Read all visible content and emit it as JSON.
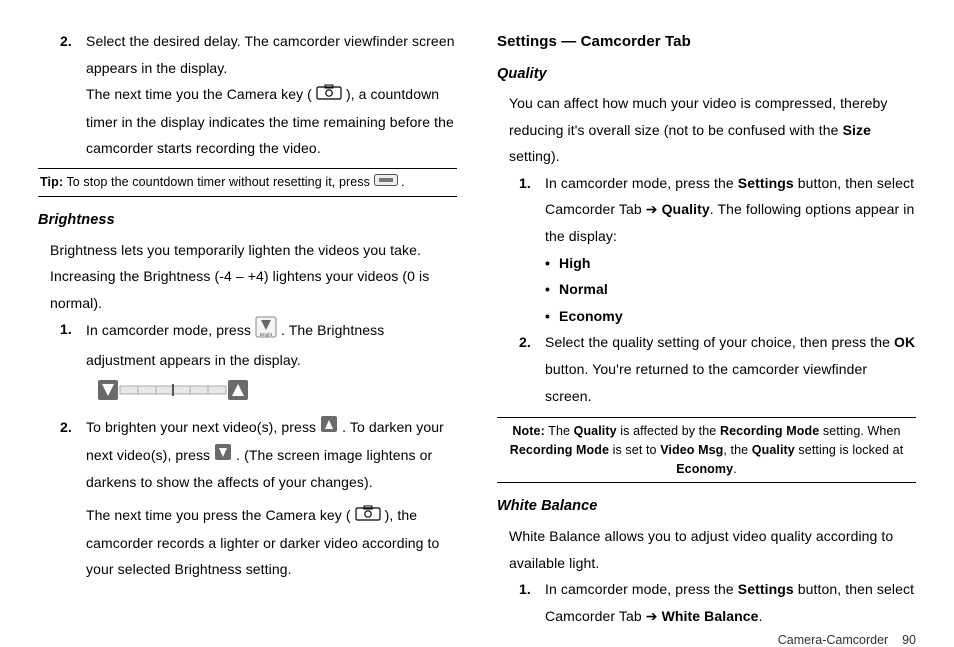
{
  "left": {
    "step2a": "Select the desired delay. The camcorder viewfinder screen appears in the display.",
    "step2b_pre": "The next time you the Camera key (",
    "step2b_post": "), a countdown timer in the display indicates the time remaining before the camcorder starts recording the video.",
    "tip_label": "Tip:",
    "tip_text_pre": " To stop the countdown timer without resetting it, press ",
    "tip_text_post": " .",
    "brightness_heading": "Brightness",
    "brightness_intro": "Brightness lets you temporarily lighten the videos you take. Increasing the Brightness (-4 – +4) lightens your videos (0 is normal).",
    "b_step1_pre": "In camcorder mode, press ",
    "b_step1_post": ". The Brightness adjustment appears in the display.",
    "b_step2_pre": "To brighten your next video(s), press ",
    "b_step2_mid": ". To darken your next video(s), press ",
    "b_step2_post": ". (The screen image lightens or darkens to show the affects of your changes).",
    "b_step2_para2_pre": "The next time you press the Camera key (",
    "b_step2_para2_post": "), the camcorder records a lighter or darker video according to your selected Brightness setting."
  },
  "right": {
    "section_heading": "Settings — Camcorder Tab",
    "quality_heading": "Quality",
    "quality_intro_a": "You can affect how much your video is compressed, thereby reducing it's overall size (not to be confused with the ",
    "quality_intro_bold": "Size",
    "quality_intro_b": " setting).",
    "q_step1_a": "In camcorder mode, press the ",
    "q_step1_bold1": "Settings",
    "q_step1_b": " button, then select Camcorder Tab ➔ ",
    "q_step1_bold2": "Quality",
    "q_step1_c": ". The following options appear in the display:",
    "q_opts": {
      "high": "High",
      "normal": "Normal",
      "economy": "Economy"
    },
    "q_step2_a": "Select the quality setting of your choice, then press the ",
    "q_step2_bold": "OK",
    "q_step2_b": " button. You're returned to the camcorder viewfinder screen.",
    "note_label": "Note:",
    "note_a": " The ",
    "note_b1": "Quality",
    "note_b": " is affected by the ",
    "note_b2": "Recording Mode",
    "note_c": " setting. When ",
    "note_b3": "Recording Mode",
    "note_d": " is set to ",
    "note_b4": "Video Msg",
    "note_e": ", the ",
    "note_b5": "Quality",
    "note_f": " setting is locked at ",
    "note_b6": "Economy",
    "note_g": ".",
    "wb_heading": "White Balance",
    "wb_intro": "White Balance allows you to adjust video quality according to available light.",
    "wb_step1_a": "In camcorder mode, press the ",
    "wb_step1_bold1": "Settings",
    "wb_step1_b": " button, then select Camcorder Tab ➔ ",
    "wb_step1_bold2": "White Balance",
    "wb_step1_c": "."
  },
  "footer": {
    "section": "Camera-Camcorder",
    "page": "90"
  },
  "nums": {
    "n1": "1.",
    "n2": "2."
  },
  "bullet": "•"
}
